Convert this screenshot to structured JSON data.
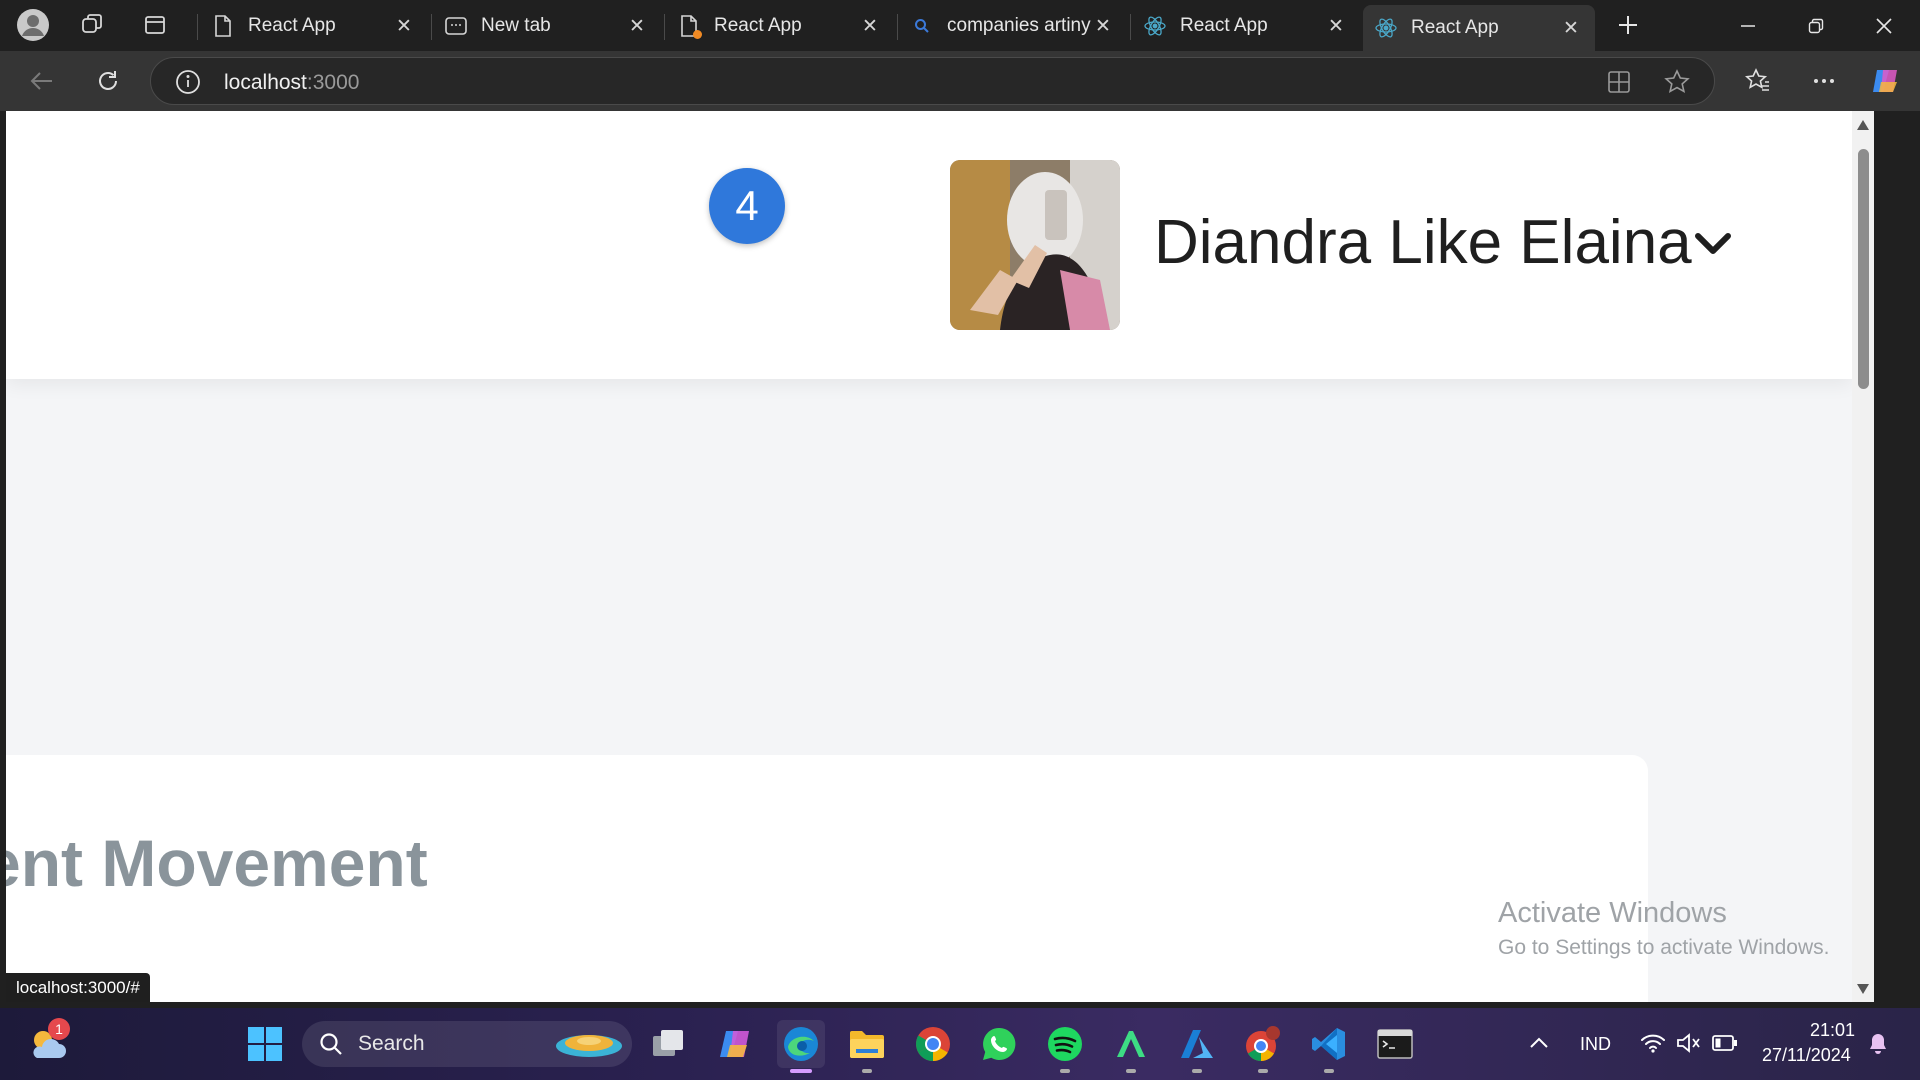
{
  "browser": {
    "tabs": [
      {
        "title": "React App",
        "favicon": "page-icon",
        "active": false
      },
      {
        "title": "New tab",
        "favicon": "newtab-icon",
        "active": false
      },
      {
        "title": "React App",
        "favicon": "page-icon",
        "active": false
      },
      {
        "title": "companies artinya",
        "favicon": "search-icon",
        "active": false
      },
      {
        "title": "React App",
        "favicon": "react-icon",
        "active": false
      },
      {
        "title": "React App",
        "favicon": "react-icon",
        "active": true
      }
    ],
    "address": {
      "host": "localhost",
      "port": ":3000"
    },
    "status_url": "localhost:3000/#"
  },
  "page": {
    "notification_count": "4",
    "user": {
      "name": "Diandra Like Elaina"
    },
    "card_title": "ent Movement",
    "watermark": {
      "title": "Activate Windows",
      "subtitle": "Go to Settings to activate Windows."
    }
  },
  "taskbar": {
    "weather_badge": "1",
    "search_placeholder": "Search",
    "apps": [
      "start-icon",
      "task-view-icon",
      "copilot-icon",
      "edge-icon",
      "file-explorer-icon",
      "chrome-icon",
      "whatsapp-icon",
      "spotify-icon",
      "android-studio-icon",
      "azure-icon",
      "chrome-profile-icon",
      "vscode-icon",
      "terminal-icon"
    ],
    "tray": {
      "language": "IND",
      "time": "21:01",
      "date": "27/11/2024"
    }
  },
  "colors": {
    "badge_blue": "#2f78db",
    "chrome_dark": "#202020",
    "toolbar": "#353535",
    "page_bg": "#f4f5f7",
    "card_title_gray": "#8a949b"
  }
}
